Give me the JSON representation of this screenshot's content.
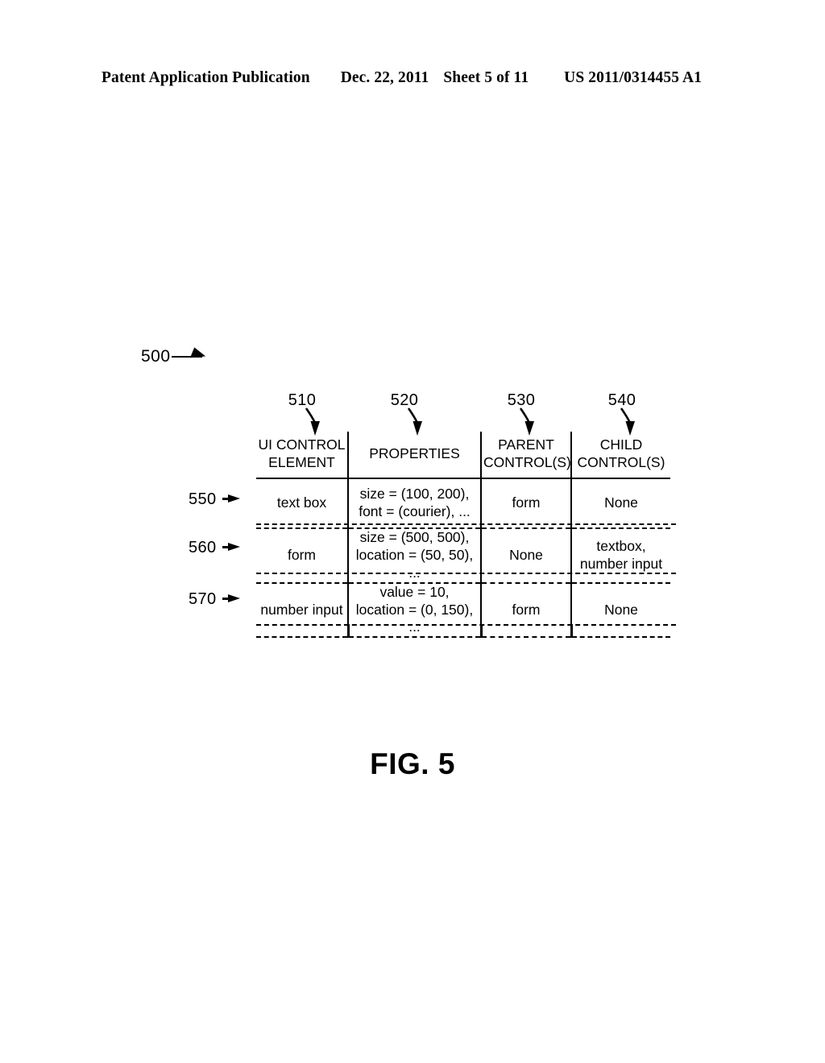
{
  "header": {
    "publication": "Patent Application Publication",
    "date": "Dec. 22, 2011",
    "sheet": "Sheet 5 of 11",
    "number": "US 2011/0314455 A1"
  },
  "figure": {
    "caption": "FIG. 5",
    "diagram_ref": "500"
  },
  "table": {
    "column_refs": [
      "510",
      "520",
      "530",
      "540"
    ],
    "row_refs": [
      "550",
      "560",
      "570"
    ],
    "columns": [
      {
        "line1": "UI CONTROL",
        "line2": "ELEMENT"
      },
      {
        "line1": "PROPERTIES",
        "line2": ""
      },
      {
        "line1": "PARENT",
        "line2": "CONTROL(S)"
      },
      {
        "line1": "CHILD",
        "line2": "CONTROL(S)"
      }
    ],
    "rows": [
      {
        "element": "text box",
        "properties_line1": "size = (100, 200),",
        "properties_line2": "font = (courier), ...",
        "parent_line1": "form",
        "parent_line2": "",
        "child_line1": "None",
        "child_line2": ""
      },
      {
        "element": "form",
        "properties_line1": "size = (500, 500),",
        "properties_line2": "location = (50, 50), ...",
        "parent_line1": "None",
        "parent_line2": "",
        "child_line1": "textbox,",
        "child_line2": "number input"
      },
      {
        "element": "number input",
        "properties_line1": "value = 10,",
        "properties_line2": "location = (0, 150), ...",
        "parent_line1": "form",
        "parent_line2": "",
        "child_line1": "None",
        "child_line2": ""
      }
    ]
  }
}
